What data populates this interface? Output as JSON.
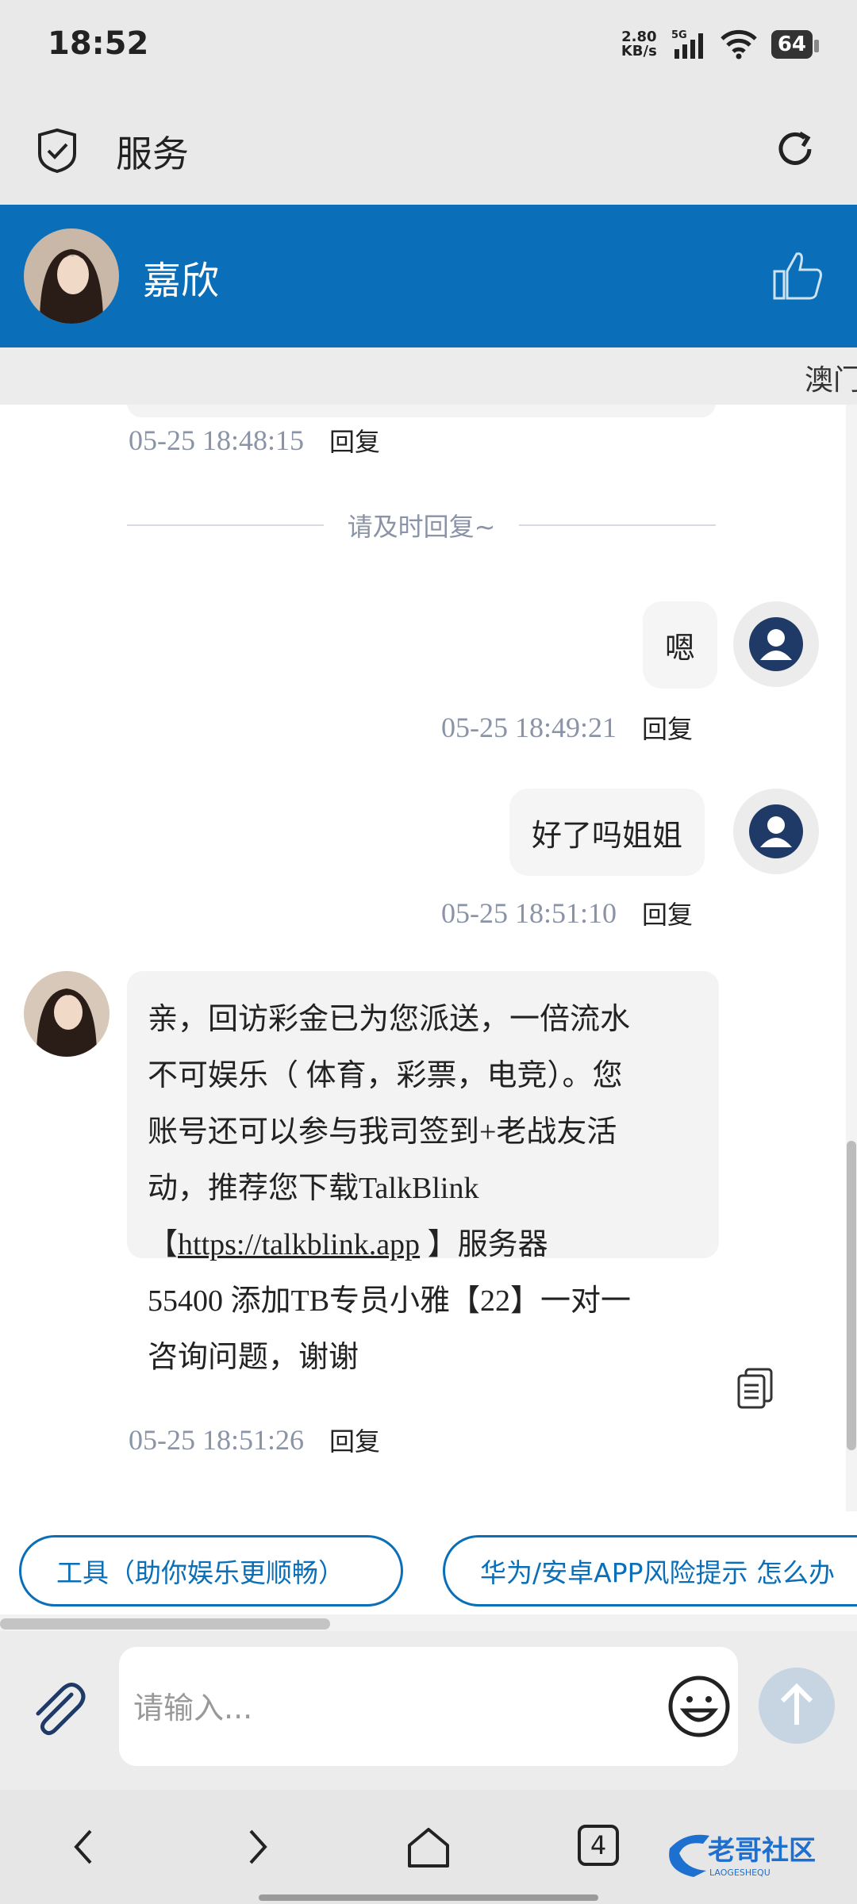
{
  "status_bar": {
    "time": "18:52",
    "net_speed_value": "2.80",
    "net_speed_unit": "KB/s",
    "network": "5G",
    "battery": "64"
  },
  "app_bar": {
    "title": "服务"
  },
  "chat_header": {
    "agent_name": "嘉欣"
  },
  "marquee": {
    "text": "澳门"
  },
  "messages": [
    {
      "time": "05-25 18:48:15",
      "reply": "回复"
    },
    {
      "divider": "请及时回复~"
    },
    {
      "side": "right",
      "text": "嗯",
      "time": "05-25 18:49:21",
      "reply": "回复"
    },
    {
      "side": "right",
      "text": "好了吗姐姐",
      "time": "05-25 18:51:10",
      "reply": "回复"
    },
    {
      "side": "left",
      "lines": [
        "亲，回访彩金已为您派送，一倍流水",
        "不可娱乐（ 体育，彩票，电竞）。您",
        "账号还可以参与我司签到+老战友活",
        "动，推荐您下载TalkBlink"
      ],
      "link_open": "【",
      "link": "https://talkblink.app",
      "link_close": " 】服务器",
      "lines_after": [
        "55400 添加TB专员小雅【22】一对一",
        "咨询问题，谢谢"
      ],
      "time": "05-25 18:51:26",
      "reply": "回复"
    }
  ],
  "quick_replies": [
    "工具（助你娱乐更顺畅）",
    "华为/安卓APP风险提示 怎么办"
  ],
  "input": {
    "placeholder": "请输入..."
  },
  "nav": {
    "tab_count": "4",
    "watermark": "老哥社区",
    "watermark_sub": "LAOGESHEQU"
  },
  "colors": {
    "header_blue": "#0a6fb8",
    "user_avatar": "#1f3a66",
    "timestamp": "#8a94a6"
  }
}
